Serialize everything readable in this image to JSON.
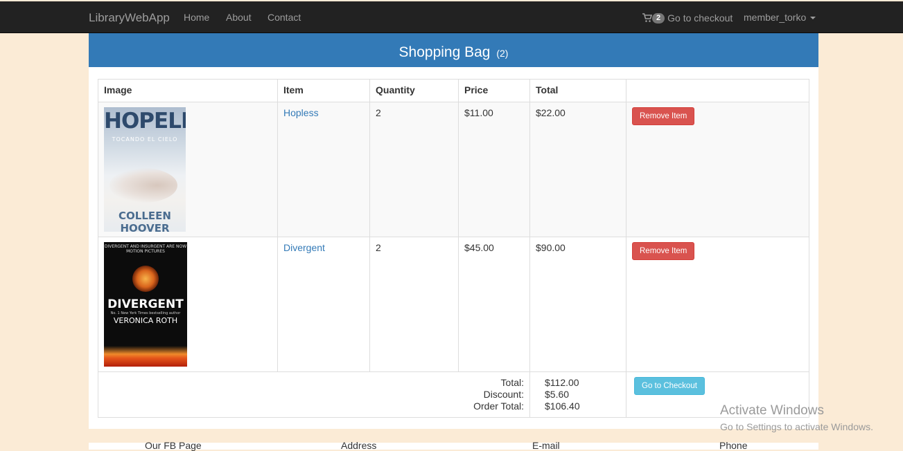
{
  "navbar": {
    "brand": "LibraryWebApp",
    "links": [
      "Home",
      "About",
      "Contact"
    ],
    "cart_count": "2",
    "checkout_label": "Go to checkout",
    "user": "member_torko"
  },
  "panel": {
    "title": "Shopping Bag",
    "count": "(2)"
  },
  "table": {
    "headers": [
      "Image",
      "Item",
      "Quantity",
      "Price",
      "Total"
    ],
    "rows": [
      {
        "name": "Hopless",
        "quantity": "2",
        "price": "$11.00",
        "total": "$22.00",
        "action": "Remove Item",
        "cover": {
          "title": "HOPELESS",
          "subtitle": "TOCANDO EL CIELO",
          "author": "COLLEEN HOOVER"
        }
      },
      {
        "name": "Divergent",
        "quantity": "2",
        "price": "$45.00",
        "total": "$90.00",
        "action": "Remove Item",
        "cover": {
          "top": "DIVERGENT AND INSURGENT ARE NOW MOTION PICTURES",
          "title": "DIVERGENT",
          "tagline": "No. 1 New York Times bestselling author",
          "author": "VERONICA ROTH"
        }
      }
    ]
  },
  "summary": {
    "total_label": "Total:",
    "total": "$112.00",
    "discount_label": "Discount:",
    "discount": "$5.60",
    "order_total_label": "Order Total:",
    "order_total": "$106.40",
    "checkout_button": "Go to Checkout"
  },
  "footer": {
    "columns": [
      "Our FB Page",
      "Address",
      "E-mail",
      "Phone"
    ]
  },
  "watermark": {
    "title": "Activate Windows",
    "subtitle": "Go to Settings to activate Windows."
  },
  "colors": {
    "navbar": "#222222",
    "panel_heading": "#337ab7",
    "danger": "#d9534f",
    "info": "#5bc0de",
    "page_bg": "#fbebd6"
  },
  "icons": [
    "shopping-cart-icon",
    "caret-down-icon"
  ]
}
